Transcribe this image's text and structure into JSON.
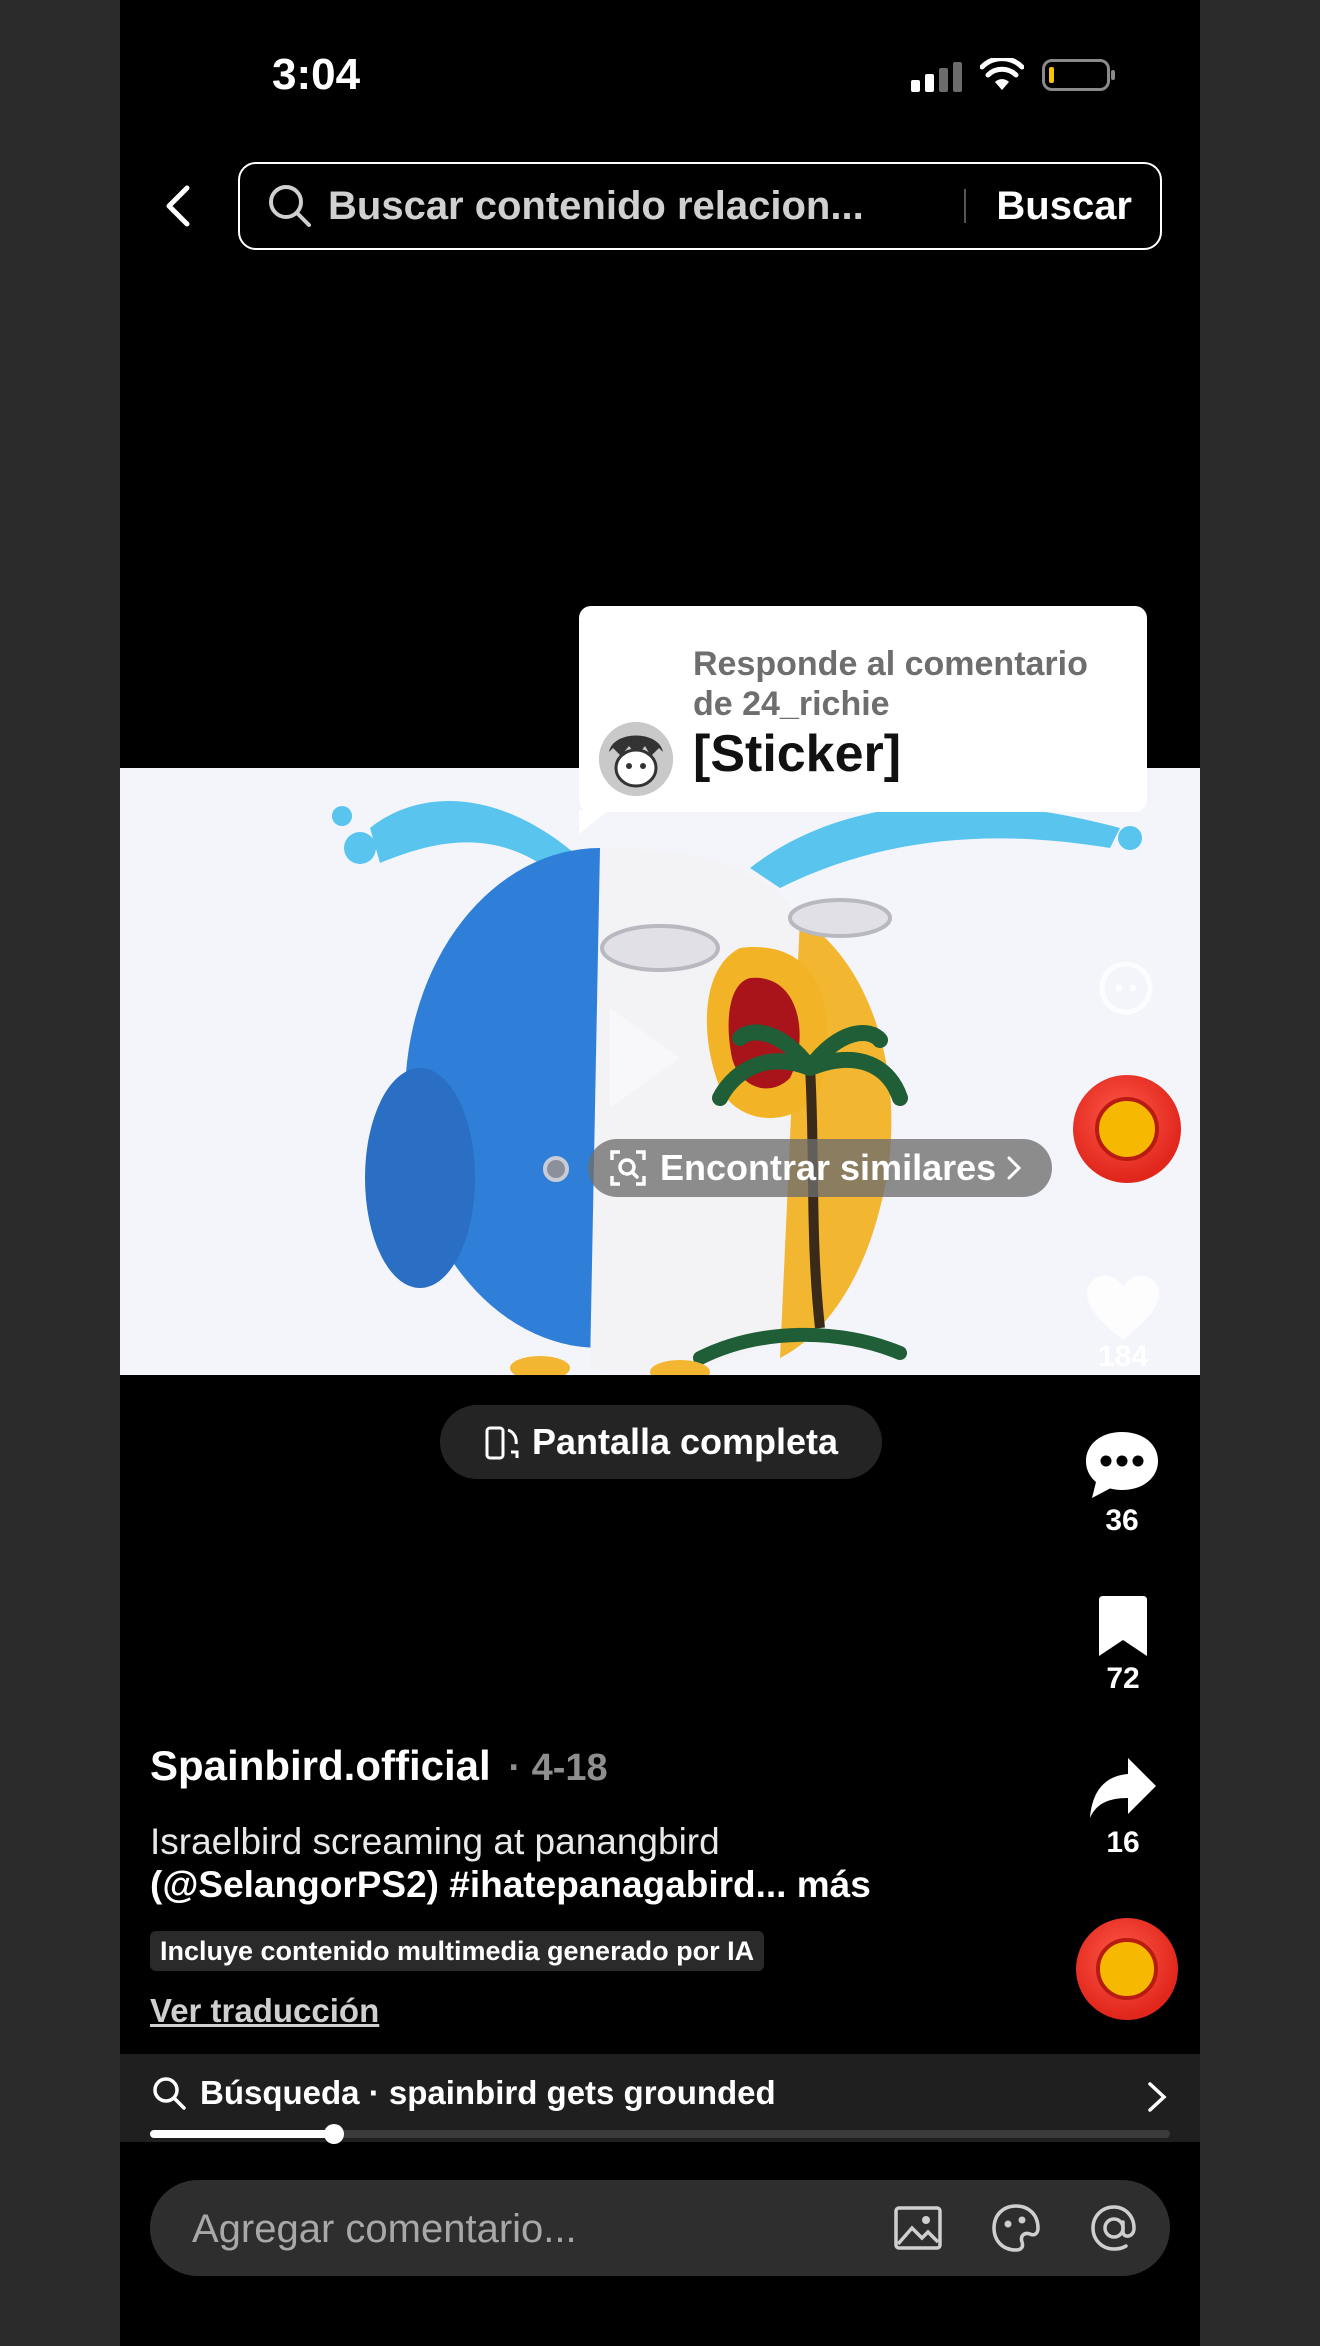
{
  "status_bar": {
    "time": "3:04"
  },
  "header": {
    "search_placeholder": "Buscar contenido relacion...",
    "search_button": "Buscar"
  },
  "reply_bubble": {
    "line1": "Responde al comentario de 24_richie",
    "line2": "[Sticker]"
  },
  "video": {
    "find_similar_label": "Encontrar similares"
  },
  "fullscreen_label": "Pantalla completa",
  "rail": {
    "like_count": "184",
    "comment_count": "36",
    "bookmark_count": "72",
    "share_count": "16"
  },
  "post": {
    "author": "Spainbird.official",
    "date": "· 4-18",
    "description_line1": "Israelbird screaming at panangbird",
    "description_handle": "(@SelangorPS2)",
    "description_tag": "#ihatepanagabird...",
    "more_label": "más",
    "ai_label": "Incluye contenido multimedia generado por IA",
    "translate_label": "Ver traducción"
  },
  "search_suggestion": {
    "label": "Búsqueda · spainbird gets grounded",
    "progress": 0.18
  },
  "comment": {
    "placeholder": "Agregar comentario..."
  },
  "colors": {
    "background": "#000000",
    "video_bg": "#f4f5fa",
    "profile_red": "#e1261c"
  }
}
